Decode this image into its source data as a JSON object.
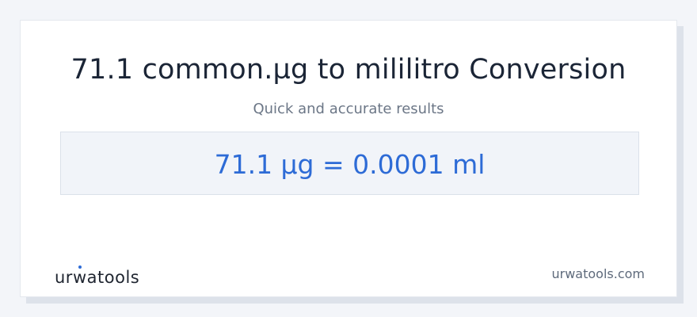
{
  "card": {
    "title": "71.1 common.µg to mililitro Conversion",
    "subtitle": "Quick and accurate results",
    "result": "71.1 µg = 0.0001 ml"
  },
  "footer": {
    "logo_text_before": "ur",
    "logo_text_accent": "w",
    "logo_text_after": "atools",
    "site": "urwatools.com"
  },
  "colors": {
    "accent": "#2d6bd6",
    "title": "#1b2536",
    "muted": "#6b7686",
    "result_bg": "#f1f4f9"
  }
}
